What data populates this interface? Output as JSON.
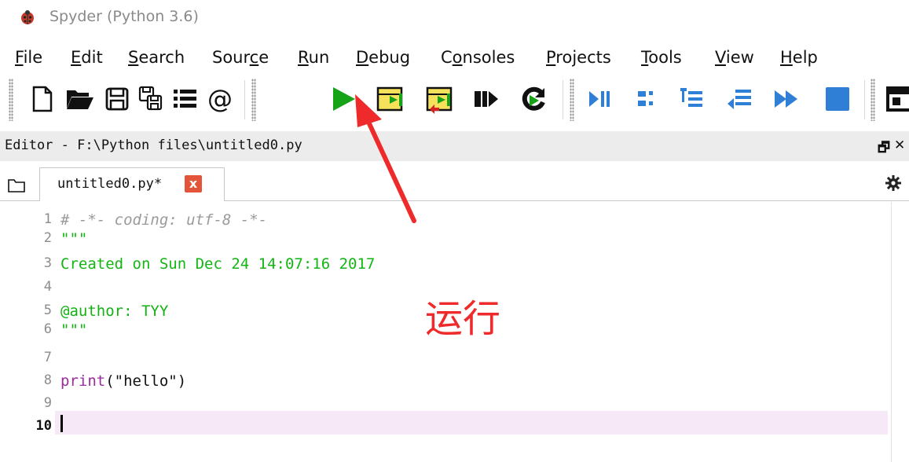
{
  "window": {
    "title": "Spyder (Python 3.6)",
    "app_icon": "spyder-ladybug-icon"
  },
  "menubar": {
    "items": [
      {
        "pre": "",
        "mnemonic": "F",
        "post": "ile"
      },
      {
        "pre": "",
        "mnemonic": "E",
        "post": "dit"
      },
      {
        "pre": "",
        "mnemonic": "S",
        "post": "earch"
      },
      {
        "pre": "Sour",
        "mnemonic": "c",
        "post": "e"
      },
      {
        "pre": "",
        "mnemonic": "R",
        "post": "un"
      },
      {
        "pre": "",
        "mnemonic": "D",
        "post": "ebug"
      },
      {
        "pre": "C",
        "mnemonic": "o",
        "post": "nsoles"
      },
      {
        "pre": "",
        "mnemonic": "P",
        "post": "rojects"
      },
      {
        "pre": "",
        "mnemonic": "T",
        "post": "ools"
      },
      {
        "pre": "",
        "mnemonic": "V",
        "post": "iew"
      },
      {
        "pre": "",
        "mnemonic": "H",
        "post": "elp"
      }
    ]
  },
  "toolbar": {
    "icons": [
      "new-file-icon",
      "open-folder-icon",
      "save-icon",
      "save-all-icon",
      "outline-list-icon",
      "at-sign-icon",
      "run-icon",
      "run-cell-icon",
      "run-cell-advance-icon",
      "run-selection-icon",
      "rerun-icon",
      "debug-icon",
      "step-icon",
      "step-into-icon",
      "step-return-icon",
      "continue-icon",
      "stop-icon",
      "maximize-pane-icon"
    ],
    "colors": {
      "green": "#1a9a1a",
      "yellow": "#f5e25a",
      "blue": "#2f7fd6"
    }
  },
  "pane": {
    "title": "Editor - F:\\Python files\\untitled0.py",
    "float_glyph": "🗗",
    "close_glyph": "✕"
  },
  "tabs": [
    {
      "label": "untitled0.py*",
      "close_glyph": "x"
    }
  ],
  "editor": {
    "lines": [
      {
        "n": "1",
        "code": "# -*- coding: utf-8 -*-"
      },
      {
        "n": "2",
        "code": "\"\"\""
      },
      {
        "n": "3",
        "code": "Created on Sun Dec 24 14:07:16 2017"
      },
      {
        "n": "4",
        "code": ""
      },
      {
        "n": "5",
        "code": "@author: TYY"
      },
      {
        "n": "6",
        "code": "\"\"\""
      },
      {
        "n": "7",
        "code": ""
      },
      {
        "n": "8",
        "code_print": "print",
        "code_args": "(\"hello\")"
      },
      {
        "n": "9",
        "code": ""
      },
      {
        "n": "10",
        "code": ""
      }
    ],
    "current_line": "10",
    "colors": {
      "comment": "#9a9a9a",
      "string": "#13b513",
      "builtin": "#9b2aa0",
      "current_line_bg": "#f6e8f6"
    }
  },
  "annotation": {
    "text": "运行",
    "color": "#ee2a2a"
  }
}
